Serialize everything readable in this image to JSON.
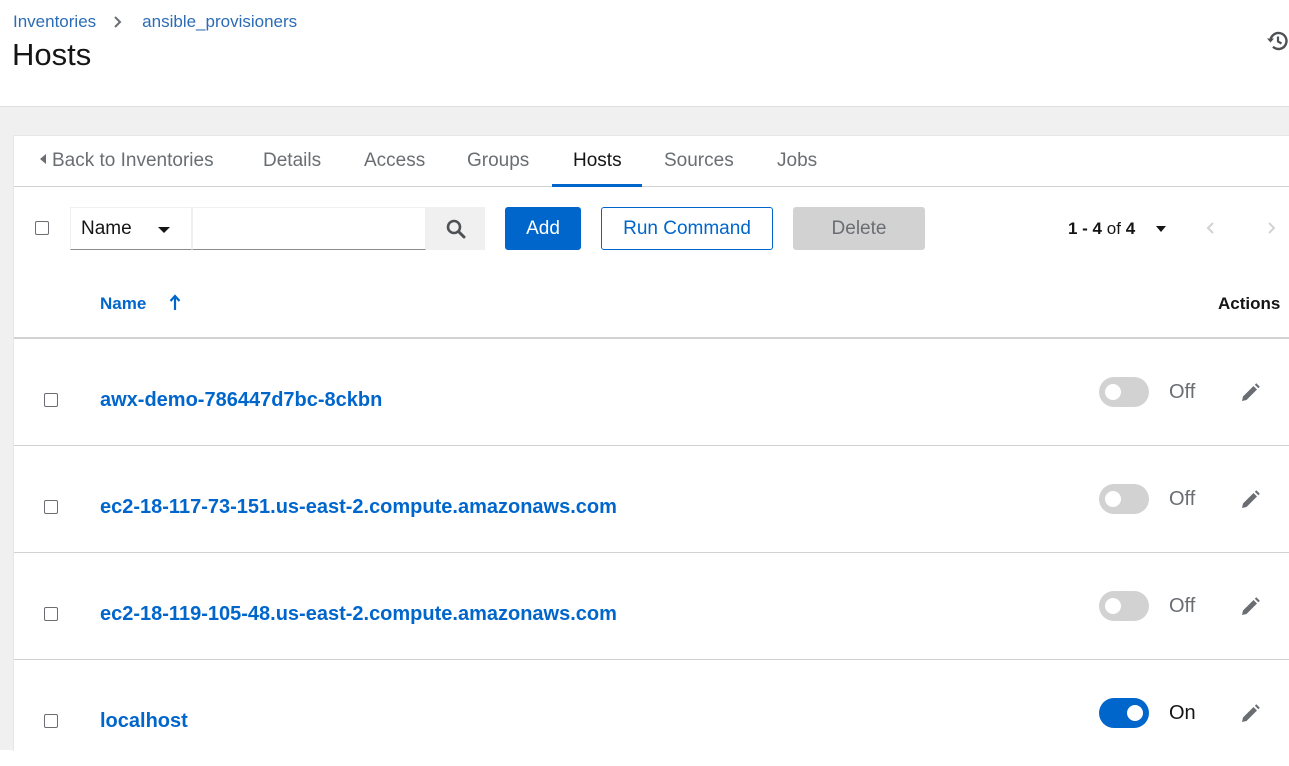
{
  "breadcrumb": {
    "root": "Inventories",
    "current": "ansible_provisioners"
  },
  "page_title": "Hosts",
  "tabs": [
    {
      "label": "Back to Inventories",
      "active": false
    },
    {
      "label": "Details",
      "active": false
    },
    {
      "label": "Access",
      "active": false
    },
    {
      "label": "Groups",
      "active": false
    },
    {
      "label": "Hosts",
      "active": true
    },
    {
      "label": "Sources",
      "active": false
    },
    {
      "label": "Jobs",
      "active": false
    }
  ],
  "toolbar": {
    "filter_field": "Name",
    "search_value": "",
    "add_label": "Add",
    "run_command_label": "Run Command",
    "delete_label": "Delete",
    "pagination": {
      "range": "1 - 4",
      "of_label": "of",
      "total": "4"
    }
  },
  "table": {
    "headers": {
      "name": "Name",
      "actions": "Actions"
    },
    "sort": "ascending",
    "rows": [
      {
        "name": "awx-demo-786447d7bc-8ckbn",
        "enabled": false,
        "toggle_label": "Off"
      },
      {
        "name": "ec2-18-117-73-151.us-east-2.compute.amazonaws.com",
        "enabled": false,
        "toggle_label": "Off"
      },
      {
        "name": "ec2-18-119-105-48.us-east-2.compute.amazonaws.com",
        "enabled": false,
        "toggle_label": "Off"
      },
      {
        "name": "localhost",
        "enabled": true,
        "toggle_label": "On"
      }
    ]
  },
  "colors": {
    "link": "#0066cc",
    "primary": "#0066cc",
    "disabled": "#d2d2d2",
    "band": "#f0f0f0"
  },
  "icons": [
    "chevron-right-icon",
    "history-icon",
    "caret-left-icon",
    "caret-down-icon",
    "search-icon",
    "angle-left-icon",
    "angle-right-icon",
    "sort-up-icon",
    "pencil-icon"
  ]
}
